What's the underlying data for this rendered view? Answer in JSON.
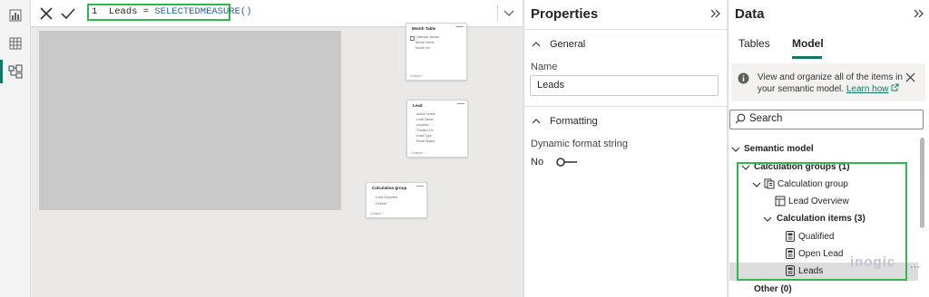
{
  "formula": {
    "line_number": "1",
    "measure_name": "Leads",
    "operator": "=",
    "function": "SELECTEDMEASURE()"
  },
  "canvas": {
    "cards": [
      {
        "title": "Month Table",
        "lines": [
          "Calendar Month",
          "Month Name",
          "Month No"
        ],
        "footer": "Collapse ^"
      },
      {
        "title": "Lead",
        "lines": [
          "Active Leads",
          "Lead Name",
          "Location",
          "Created On",
          "Lead Type",
          "Email Status"
        ],
        "footer": "Collapse ^"
      },
      {
        "title": "Calculation group",
        "lines": [
          "Lead Overview",
          "Ordinal"
        ],
        "footer": "Collapse ^"
      }
    ]
  },
  "properties": {
    "title": "Properties",
    "general_label": "General",
    "name_label": "Name",
    "name_value": "Leads",
    "formatting_label": "Formatting",
    "dynamic_label": "Dynamic format string",
    "toggle_label": "No",
    "toggle_on": false
  },
  "data_pane": {
    "title": "Data",
    "tabs": [
      "Tables",
      "Model"
    ],
    "active_tab": "Model",
    "info_text": "View and organize all of the items in your semantic model.",
    "info_link": "Learn how",
    "search_placeholder": "Search",
    "tree": {
      "semantic_model": "Semantic model",
      "calc_groups": "Calculation groups (1)",
      "calc_group": "Calculation group",
      "lead_overview": "Lead Overview",
      "calc_items": "Calculation items (3)",
      "items": [
        "Qualified",
        "Open Lead",
        "Leads"
      ],
      "other": "Other (0)"
    },
    "accent_color": "#117865",
    "highlight_color": "#2fb84c"
  },
  "watermark": "inogic"
}
